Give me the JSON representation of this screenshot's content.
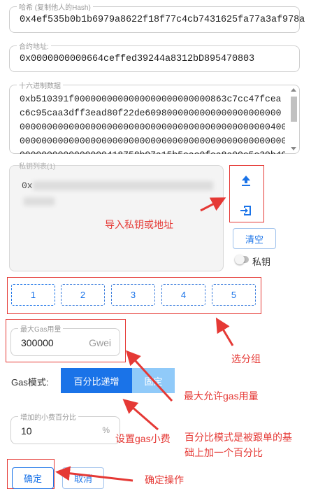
{
  "hash": {
    "label": "哈希 (复制他人的Hash)",
    "value": "0x4ef535b0b1b6979a8622f18f77c4cb7431625fa77a3af978a"
  },
  "contract": {
    "label": "合约地址:",
    "value": "0x0000000000664ceffed39244a8312bD895470803"
  },
  "hexdata": {
    "label": "十六进制数据",
    "lines": [
      "0xb510391f0000000000000000000000000863c7cc47fcea",
      "c6c95caa3dff3ead80f22de6098000000000000000000000",
      "000000000000000000000000000000000000000000000040000",
      "00000000000000000000000000000000000000000000000000000",
      "0000000000000000418758b97a15b5eac0fea8a00e5e39b49"
    ]
  },
  "keys": {
    "label": "私钥列表(1)",
    "prefix": "0x"
  },
  "side": {
    "clear_label": "清空",
    "toggle_label": "私钥",
    "upload_icon": "upload-icon",
    "import_icon": "import-icon"
  },
  "groups": [
    "1",
    "2",
    "3",
    "4",
    "5"
  ],
  "max_gas": {
    "label": "最大Gas用量",
    "value": "300000",
    "unit": "Gwei"
  },
  "gas_mode": {
    "label": "Gas模式:",
    "options": [
      "百分比递增",
      "固定"
    ],
    "selected": "百分比递增"
  },
  "tip": {
    "label": "增加的小费百分比",
    "value": "10",
    "unit": "%"
  },
  "actions": {
    "confirm_label": "确定",
    "cancel_label": "取消"
  },
  "annotations": {
    "import": "导入私钥或地址",
    "groups": "选分组",
    "max_gas": "最大允许gas用量",
    "tip": "设置gas小费",
    "mode_line1": "百分比模式是被跟单的基",
    "mode_line2": "础上加一个百分比",
    "confirm": "确定操作"
  },
  "colors": {
    "accent": "#1a73e8",
    "annotation": "#e53935",
    "seg_active": "#1a73e8",
    "seg_inactive": "#90caf9"
  }
}
